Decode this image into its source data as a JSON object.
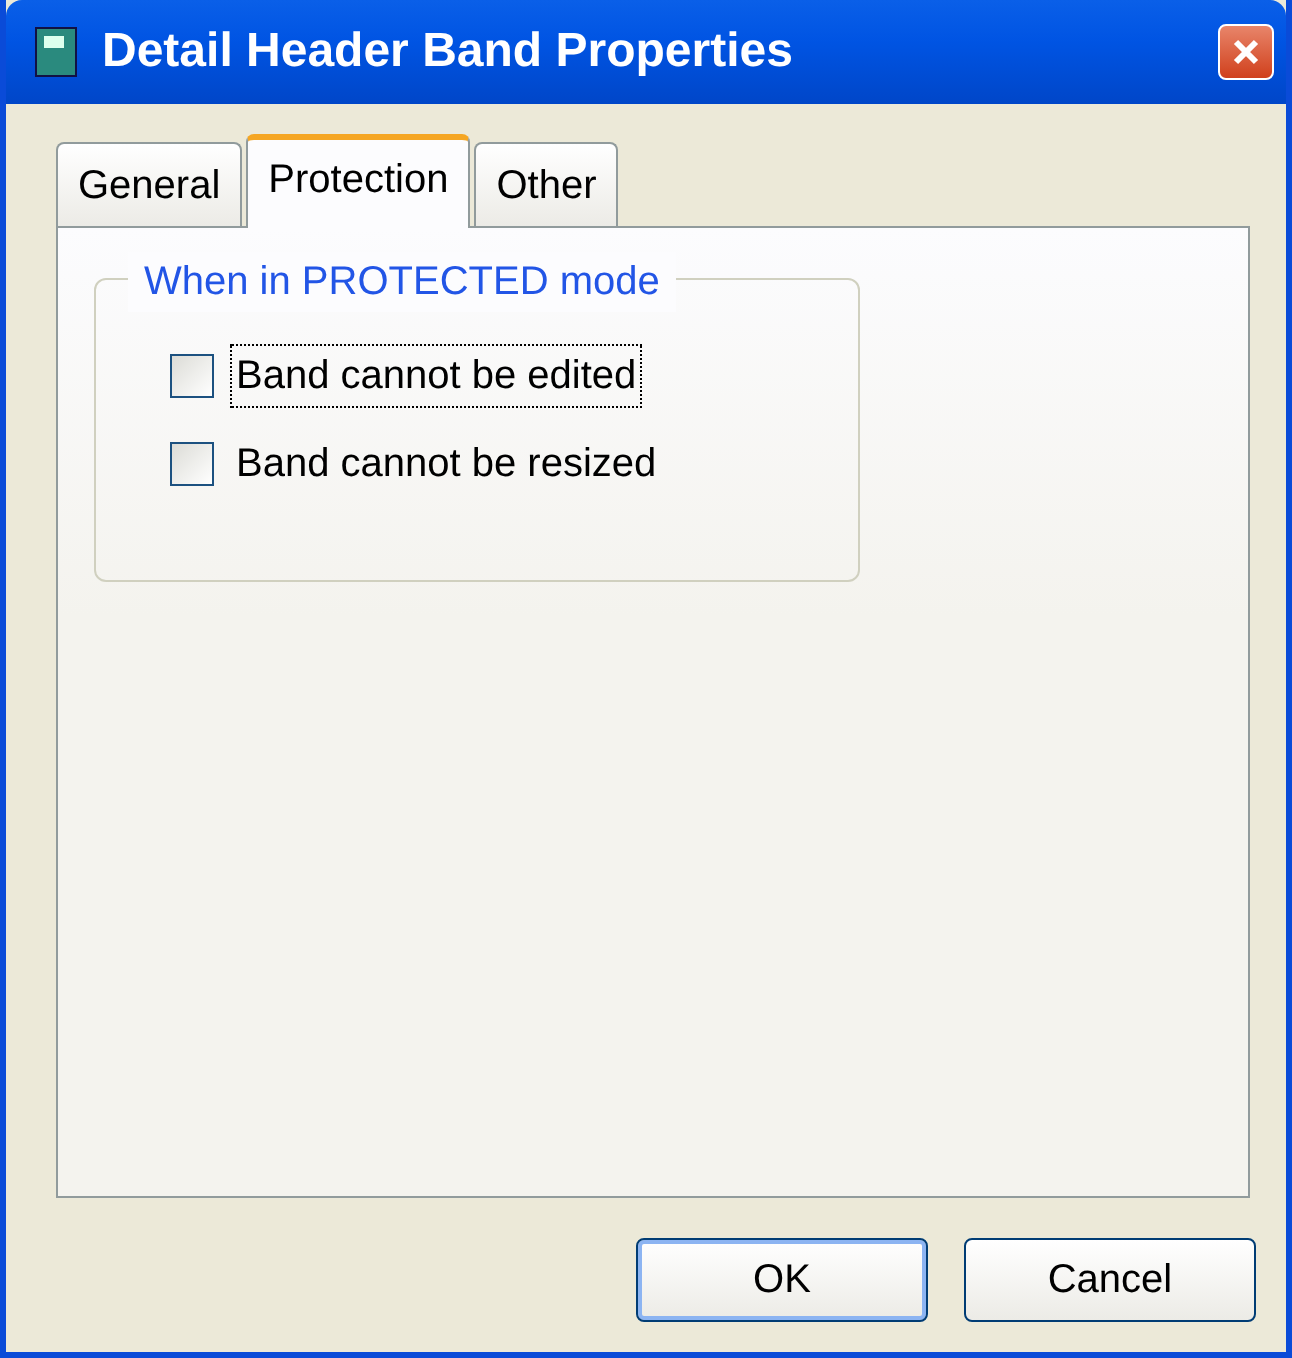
{
  "window": {
    "title": "Detail Header Band Properties"
  },
  "tabs": [
    {
      "label": "General",
      "selected": false
    },
    {
      "label": "Protection",
      "selected": true
    },
    {
      "label": "Other",
      "selected": false
    }
  ],
  "group": {
    "title": "When in PROTECTED mode",
    "checkboxes": [
      {
        "label": "Band cannot be edited",
        "checked": false,
        "focused": true
      },
      {
        "label": "Band cannot be resized",
        "checked": false,
        "focused": false
      }
    ]
  },
  "buttons": [
    {
      "label": "OK",
      "default": true
    },
    {
      "label": "Cancel",
      "default": false
    }
  ]
}
